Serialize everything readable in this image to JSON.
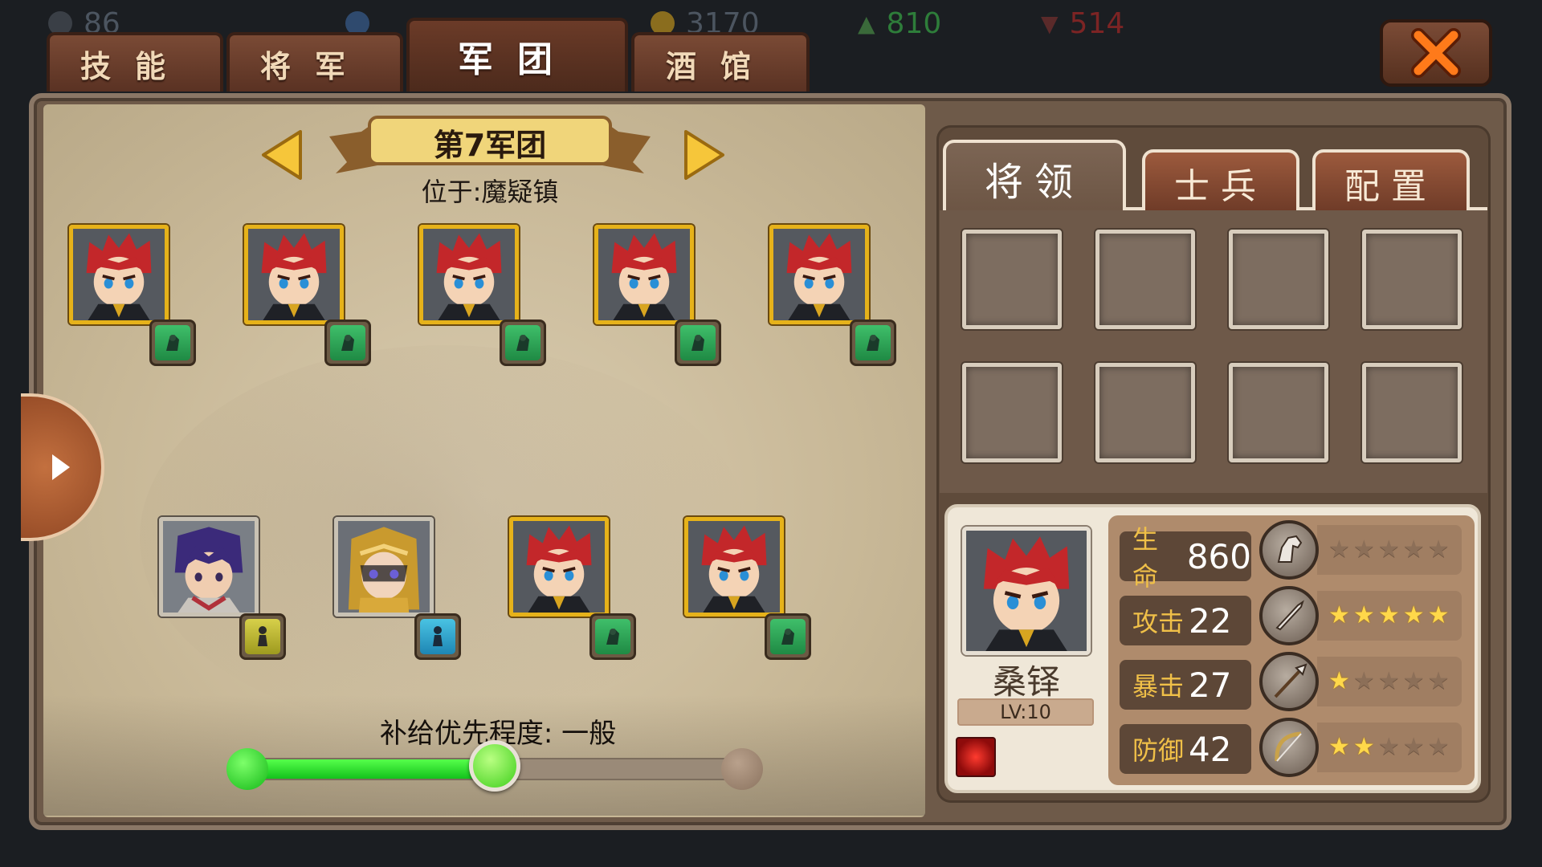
{
  "status_bar": {
    "value_1": "86",
    "value_2": "3170",
    "up_value": "810",
    "down_value": "514"
  },
  "main_tabs": [
    {
      "label": "技能",
      "active": false
    },
    {
      "label": "将军",
      "active": false
    },
    {
      "label": "军团",
      "active": true
    },
    {
      "label": "酒馆",
      "active": false
    }
  ],
  "corps": {
    "name": "第7军团",
    "location": "位于:魔疑镇"
  },
  "generals": [
    {
      "portrait": "red-hair-general",
      "unit": "green-knight-icon",
      "frame": "gold"
    },
    {
      "portrait": "red-hair-general",
      "unit": "green-knight-icon",
      "frame": "gold"
    },
    {
      "portrait": "red-hair-general",
      "unit": "green-knight-icon",
      "frame": "gold"
    },
    {
      "portrait": "red-hair-general",
      "unit": "green-knight-icon",
      "frame": "gold"
    },
    {
      "portrait": "red-hair-general",
      "unit": "green-knight-icon",
      "frame": "gold"
    },
    {
      "portrait": "purple-hair-general",
      "unit": "yellow-soldier-icon",
      "frame": "silver"
    },
    {
      "portrait": "masked-gold-general",
      "unit": "cyan-soldier-icon",
      "frame": "silver"
    },
    {
      "portrait": "red-hair-general",
      "unit": "green-knight-icon",
      "frame": "gold"
    },
    {
      "portrait": "red-hair-general",
      "unit": "green-knight-icon",
      "frame": "gold"
    }
  ],
  "supply": {
    "label": "补给优先程度: 一般",
    "level": 0.5
  },
  "sub_tabs": [
    {
      "label": "将领",
      "active": true
    },
    {
      "label": "士兵",
      "active": false
    },
    {
      "label": "配置",
      "active": false
    }
  ],
  "equipment_slots": 8,
  "selected_general": {
    "name": "桑铎",
    "level": "LV:10",
    "stats": [
      {
        "label": "生命",
        "value": "860",
        "equip_icon": "horse-icon",
        "stars": 0
      },
      {
        "label": "攻击",
        "value": "22",
        "equip_icon": "sword-icon",
        "stars": 5
      },
      {
        "label": "暴击",
        "value": "27",
        "equip_icon": "spear-icon",
        "stars": 1
      },
      {
        "label": "防御",
        "value": "42",
        "equip_icon": "bow-icon",
        "stars": 2
      }
    ],
    "max_stars": 5
  },
  "colors": {
    "gold_frame": "#e6b21a",
    "star_on": "#ffd84a",
    "stat_label": "#f0c048",
    "slider_green": "#13c21c"
  }
}
